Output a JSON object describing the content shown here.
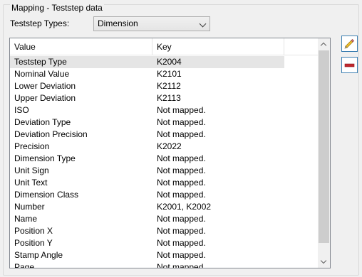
{
  "groupbox": {
    "title": "Mapping - Teststep data"
  },
  "teststep_types": {
    "label": "Teststep Types:",
    "selected": "Dimension"
  },
  "table": {
    "columns": [
      "Value",
      "Key"
    ],
    "rows": [
      {
        "value": "Teststep Type",
        "key": "K2004"
      },
      {
        "value": "Nominal Value",
        "key": "K2101"
      },
      {
        "value": "Lower Deviation",
        "key": "K2112"
      },
      {
        "value": "Upper Deviation",
        "key": "K2113"
      },
      {
        "value": "ISO",
        "key": "Not mapped."
      },
      {
        "value": "Deviation Type",
        "key": "Not mapped."
      },
      {
        "value": "Deviation Precision",
        "key": "Not mapped."
      },
      {
        "value": "Precision",
        "key": "K2022"
      },
      {
        "value": "Dimension Type",
        "key": "Not mapped."
      },
      {
        "value": "Unit Sign",
        "key": "Not mapped."
      },
      {
        "value": "Unit Text",
        "key": "Not mapped."
      },
      {
        "value": "Dimension Class",
        "key": "Not mapped."
      },
      {
        "value": "Number",
        "key": "K2001, K2002"
      },
      {
        "value": "Name",
        "key": "Not mapped."
      },
      {
        "value": "Position X",
        "key": "Not mapped."
      },
      {
        "value": "Position Y",
        "key": "Not mapped."
      },
      {
        "value": "Stamp Angle",
        "key": "Not mapped."
      },
      {
        "value": "Page",
        "key": "Not mapped."
      }
    ],
    "selected_row": 0
  },
  "side_buttons": {
    "edit_icon": "pencil-icon",
    "remove_icon": "minus-icon",
    "remove_color": "#c1272d"
  }
}
